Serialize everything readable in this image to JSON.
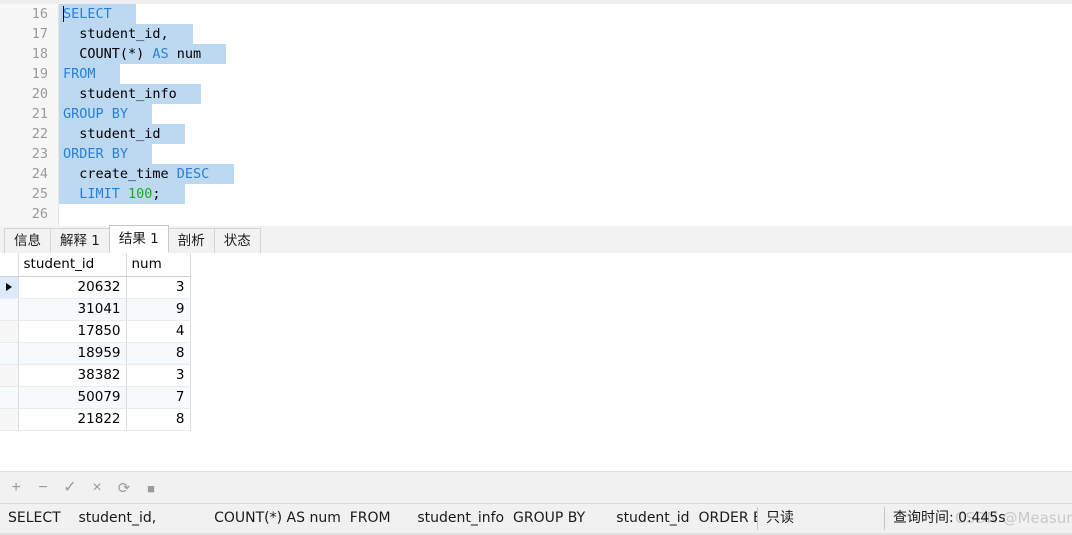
{
  "editor": {
    "first_line_number": 16,
    "lines": [
      {
        "n": 16,
        "indent": 0,
        "tokens": [
          {
            "t": "SELECT",
            "k": "kw"
          }
        ],
        "selected": true,
        "caret": true
      },
      {
        "n": 17,
        "indent": 2,
        "tokens": [
          {
            "t": "student_id,",
            "k": "plain"
          }
        ],
        "selected": true
      },
      {
        "n": 18,
        "indent": 2,
        "tokens": [
          {
            "t": "COUNT(*) ",
            "k": "plain"
          },
          {
            "t": "AS",
            "k": "kw"
          },
          {
            "t": " num",
            "k": "plain"
          }
        ],
        "selected": true
      },
      {
        "n": 19,
        "indent": 0,
        "tokens": [
          {
            "t": "FROM",
            "k": "kw"
          }
        ],
        "selected": true
      },
      {
        "n": 20,
        "indent": 2,
        "tokens": [
          {
            "t": "student_info",
            "k": "plain"
          }
        ],
        "selected": true
      },
      {
        "n": 21,
        "indent": 0,
        "tokens": [
          {
            "t": "GROUP BY",
            "k": "kw"
          }
        ],
        "selected": true
      },
      {
        "n": 22,
        "indent": 2,
        "tokens": [
          {
            "t": "student_id",
            "k": "plain"
          }
        ],
        "selected": true
      },
      {
        "n": 23,
        "indent": 0,
        "tokens": [
          {
            "t": "ORDER BY",
            "k": "kw"
          }
        ],
        "selected": true
      },
      {
        "n": 24,
        "indent": 2,
        "tokens": [
          {
            "t": "create_time ",
            "k": "plain"
          },
          {
            "t": "DESC",
            "k": "kw"
          }
        ],
        "selected": true
      },
      {
        "n": 25,
        "indent": 2,
        "tokens": [
          {
            "t": "LIMIT ",
            "k": "kw"
          },
          {
            "t": "100",
            "k": "num-lit"
          },
          {
            "t": ";",
            "k": "plain"
          }
        ],
        "selected": true
      },
      {
        "n": 26,
        "indent": 0,
        "tokens": [],
        "selected": false
      }
    ],
    "colors": {
      "keyword": "#2a7fd4",
      "number_literal": "#1fa81f",
      "plain_text": "#000000",
      "selection": "#bdd9f2",
      "gutter_bg": "#f7f7f7",
      "line_number": "#9a9a9a"
    }
  },
  "tabs": [
    {
      "label": "信息",
      "active": false
    },
    {
      "label": "解释 1",
      "active": false
    },
    {
      "label": "结果 1",
      "active": true
    },
    {
      "label": "剖析",
      "active": false
    },
    {
      "label": "状态",
      "active": false
    }
  ],
  "result_grid": {
    "columns": [
      "student_id",
      "num"
    ],
    "selected_column": "student_id",
    "current_row_index": 0,
    "rows": [
      {
        "student_id": "20632",
        "num": "3"
      },
      {
        "student_id": "31041",
        "num": "9"
      },
      {
        "student_id": "17850",
        "num": "4"
      },
      {
        "student_id": "18959",
        "num": "8"
      },
      {
        "student_id": "38382",
        "num": "3"
      },
      {
        "student_id": "50079",
        "num": "7"
      },
      {
        "student_id": "21822",
        "num": "8"
      }
    ]
  },
  "grid_toolbar": [
    {
      "icon": "plus-icon",
      "glyph": "+"
    },
    {
      "icon": "minus-icon",
      "glyph": "−"
    },
    {
      "icon": "check-icon",
      "glyph": "✓"
    },
    {
      "icon": "cancel-icon",
      "glyph": "×"
    },
    {
      "icon": "refresh-icon",
      "glyph": "⟳"
    },
    {
      "icon": "stop-icon",
      "glyph": "■"
    }
  ],
  "statusbar": {
    "sql_preview": "SELECT    student_id,             COUNT(*) AS num  FROM      student_info  GROUP BY       student_id  ORDER BY",
    "readonly_label": "只读",
    "query_time_label": "查询时间: 0.445s",
    "watermark": "CSDN @MeasureBro"
  }
}
